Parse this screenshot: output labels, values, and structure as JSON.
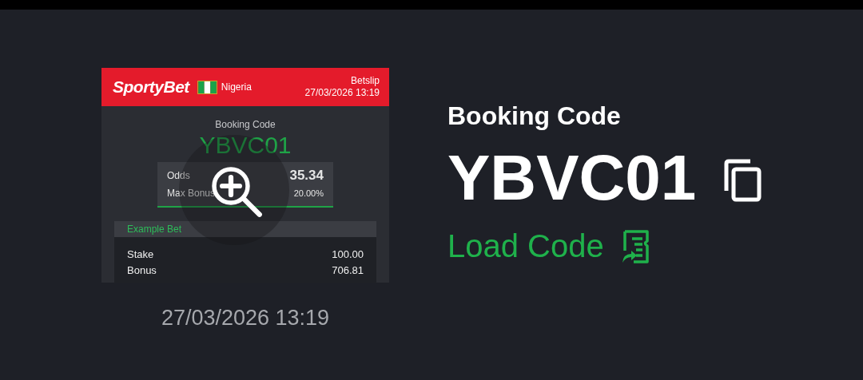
{
  "preview": {
    "brand": "SportyBet",
    "country": "Nigeria",
    "slip_title": "Betslip",
    "slip_time": "27/03/2026 13:19",
    "code_label": "Booking Code",
    "code": "YBVC01",
    "summary": [
      {
        "label": "Odds",
        "value": "35.34",
        "kind": "major"
      },
      {
        "label": "Max Bonus",
        "value": "20.00%",
        "kind": "minor"
      }
    ],
    "example_title": "Example Bet",
    "example_rows": [
      {
        "label": "Stake",
        "value": "100.00"
      },
      {
        "label": "Bonus",
        "value": "706.81"
      }
    ]
  },
  "timestamp": "27/03/2026 13:19",
  "booking": {
    "label": "Booking Code",
    "code": "YBVC01",
    "load_button": "Load Code"
  }
}
